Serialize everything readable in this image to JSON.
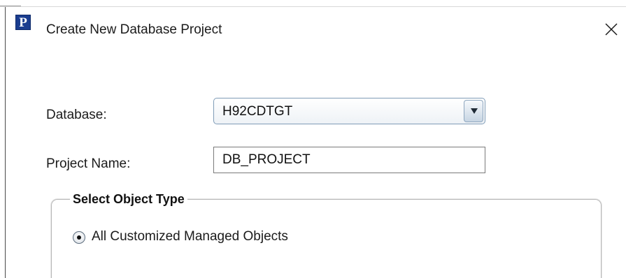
{
  "window": {
    "title": "Create New Database Project",
    "icon_letter": "P",
    "icon_name": "app-p-icon",
    "close_icon": "close-icon",
    "close_glyph": "✕"
  },
  "form": {
    "database": {
      "label": "Database:",
      "value": "H92CDTGT",
      "arrow_icon": "chevron-down-icon"
    },
    "project_name": {
      "label": "Project Name:",
      "value": "DB_PROJECT"
    },
    "object_type": {
      "legend": "Select Object Type",
      "options": [
        {
          "label": "All Customized Managed Objects",
          "selected": true
        }
      ]
    }
  },
  "colors": {
    "icon_background": "#1a3d8f",
    "combo_border": "#7f9cb7",
    "text": "#1b1b1b"
  }
}
